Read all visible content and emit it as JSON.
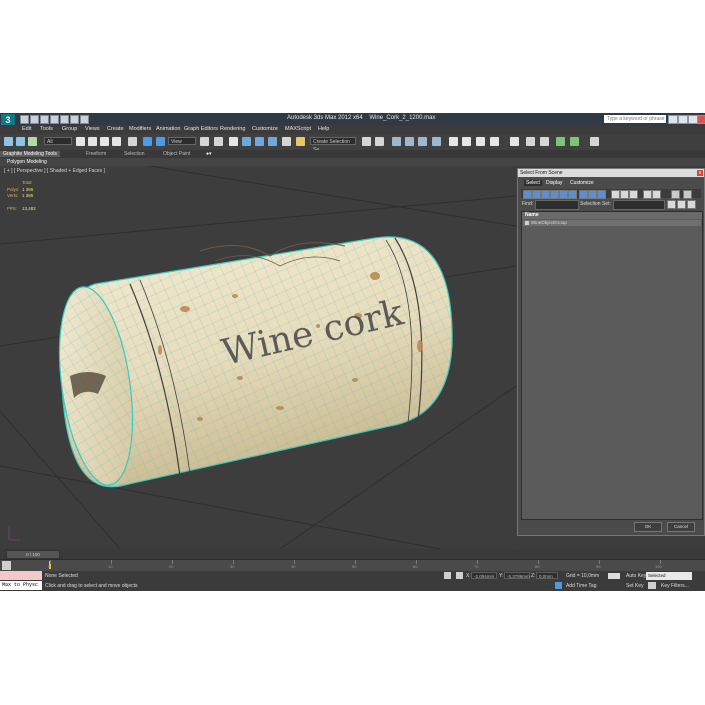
{
  "app": {
    "title_app": "Autodesk 3ds Max  2012 x64",
    "title_file": "Wine_Cork_2_1200.max",
    "search_placeholder": "Type a keyword or phrase",
    "logo": "3"
  },
  "menu": [
    "Edit",
    "Tools",
    "Group",
    "Views",
    "Create",
    "Modifiers",
    "Animation",
    "Graph Editors",
    "Rendering",
    "Customize",
    "MAXScript",
    "Help"
  ],
  "toolbar": {
    "selection_filter": "All",
    "reference_coord": "View",
    "named_selection": "Create Selection Se"
  },
  "ribbon": {
    "tabs": [
      "Graphite Modeling Tools",
      "Freeform",
      "Selection",
      "Object Paint"
    ],
    "panel_label": "Polygon Modeling"
  },
  "viewport": {
    "label": "[ + ] [ Perspective ] [ Shaded + Edged Faces ]",
    "stats": {
      "total_label": "Total",
      "polys_label": "Polys:",
      "polys_value": "1 386",
      "verts_label": "Verts:",
      "verts_value": "1 385",
      "fps_label": "FPS:",
      "fps_value": "13,482"
    },
    "cork_text": "Wine cork"
  },
  "dialog": {
    "title": "Select From Scene",
    "close": "x",
    "menu": [
      "Select",
      "Display",
      "Customize"
    ],
    "find_label": "Find:",
    "selection_set_label": "Selection Set:",
    "column_name": "Name",
    "rows": [
      "WineObjectGroup"
    ],
    "ok": "OK",
    "cancel": "Cancel"
  },
  "timeline": {
    "slider": "0 / 100",
    "ticks": [
      "0",
      "10",
      "20",
      "30",
      "40",
      "50",
      "60",
      "70",
      "80",
      "90",
      "100"
    ]
  },
  "status": {
    "maxscript_text": "Max to Physc",
    "selection": "None Selected",
    "prompt": "Click and drag to select and move objects",
    "x_label": "X:",
    "x_value": "-2,094mm",
    "y_label": "Y:",
    "y_value": "-5,3786mm",
    "z_label": "Z:",
    "z_value": "0,0mm",
    "grid": "Grid = 10,0mm",
    "add_time_tag": "Add Time Tag",
    "auto_key": "Auto Key",
    "auto_key_mode": "Selected",
    "set_key": "Set Key",
    "key_filters": "Key Filters..."
  }
}
